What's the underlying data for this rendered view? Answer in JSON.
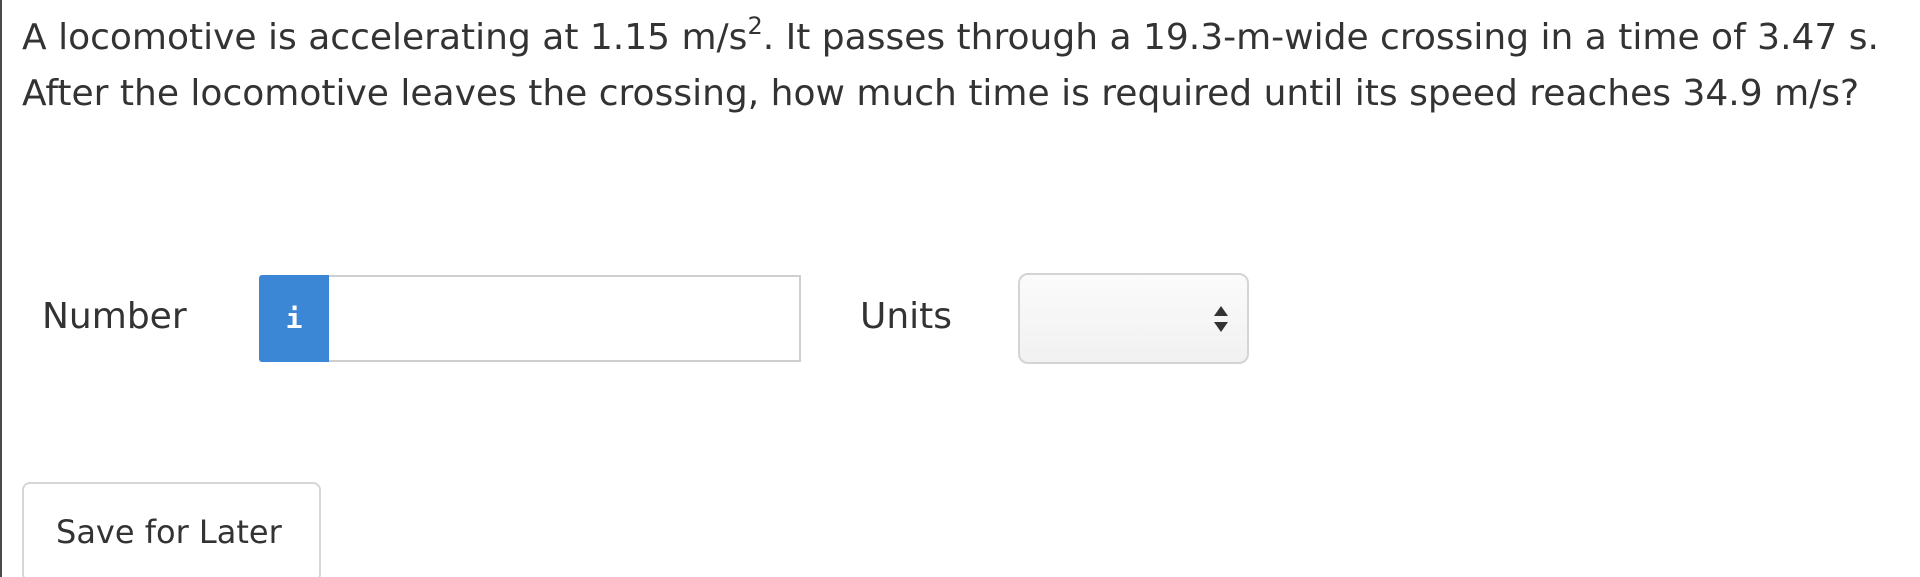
{
  "question": {
    "text_before_exponent": "A locomotive is accelerating at 1.15 m/s",
    "exponent": "2",
    "text_after_exponent": ". It passes through a 19.3-m-wide crossing in a time of 3.47 s. After the locomotive leaves the crossing, how much time is required until its speed reaches 34.9 m/s?"
  },
  "answer": {
    "number_label": "Number",
    "info_icon_glyph": "i",
    "info_icon": "info-icon",
    "number_value": "",
    "number_placeholder": "",
    "units_label": "Units",
    "units_selected": "",
    "units_arrows_icon": "up-down-arrows-icon"
  },
  "actions": {
    "save_for_later_label": "Save for Later"
  },
  "colors": {
    "info_tab": "#3b87d6",
    "text": "#333333",
    "border": "#cfcfcf"
  }
}
